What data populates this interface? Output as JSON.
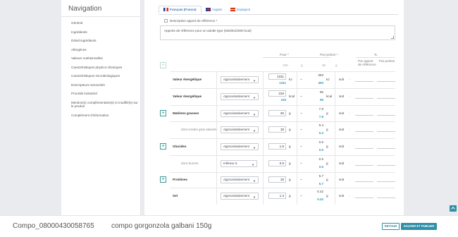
{
  "sidebar": {
    "title": "Navigation",
    "items": [
      {
        "label": "Général"
      },
      {
        "label": "Ingrédients"
      },
      {
        "label": "Détail ingrédients"
      },
      {
        "label": "Allergènes"
      },
      {
        "label": "Valeurs nutritionnelles"
      },
      {
        "label": "Caractéristiques physico-chimiques"
      },
      {
        "label": "Caractéristiques microbiologiques"
      },
      {
        "label": "Descripteurs sensoriels"
      },
      {
        "label": "Procédé industriel"
      },
      {
        "label": "Mention(s) complémentaire(s) si modifié(s) sur le produit"
      },
      {
        "label": "Complément d'information"
      }
    ]
  },
  "lang_tabs": [
    {
      "label": "Français (France)",
      "flag": "fr",
      "active": true
    },
    {
      "label": "Anglais",
      "flag": "en",
      "active": false
    },
    {
      "label": "Espagnol",
      "flag": "es",
      "active": false
    }
  ],
  "description": {
    "label": "Description apport de référence *",
    "value": "Apports de référence pour un adulte type (8400kJ/2000 kcal)"
  },
  "table_header": {
    "pour": "Pour",
    "pour_req": "*",
    "par_portion": "Par portion",
    "par_portion_req": "*",
    "pct": "%",
    "pour_value": "100",
    "pour_unit": "g",
    "portion_value": "30",
    "portion_unit": "g",
    "col_apport": "Par apport de référence",
    "col_portion": "Par portion"
  },
  "rows": [
    {
      "label": "Valeur énergétique",
      "sub": false,
      "plus": false,
      "select": "Approximativement",
      "value": "1311",
      "calc": "1311",
      "unit": "kJ",
      "portion": "393",
      "portion_calc": "393",
      "portion_unit": "kJ",
      "soit": "soit"
    },
    {
      "label": "Valeur énergétique",
      "sub": false,
      "plus": false,
      "select": "Approximativement",
      "value": "316",
      "calc": "316",
      "unit": "kcal",
      "portion": "95",
      "portion_calc": "95",
      "portion_unit": "kcal",
      "soit": "soit"
    },
    {
      "label": "Matières grasses",
      "sub": false,
      "plus": true,
      "select": "Approximativement",
      "value": "26",
      "calc": "",
      "unit": "g",
      "portion": "7.8",
      "portion_calc": "7.8",
      "portion_unit": "g",
      "soit": "soit"
    },
    {
      "label": "dont Acides gras saturés",
      "sub": true,
      "plus": false,
      "select": "Approximativement",
      "value": "18",
      "calc": "",
      "unit": "g",
      "portion": "5.4",
      "portion_calc": "5.4",
      "portion_unit": "g",
      "soit": "soit"
    },
    {
      "label": "Glucides",
      "sub": false,
      "plus": true,
      "select": "Approximativement",
      "value": "1.5",
      "calc": "",
      "unit": "g",
      "portion": "0.5",
      "portion_calc": "0.5",
      "portion_unit": "g",
      "soit": "soit"
    },
    {
      "label": "dont Sucres",
      "sub": true,
      "plus": false,
      "select": "Inférieur à",
      "value": "0.5",
      "calc": "",
      "unit": "g",
      "portion": "0.5",
      "portion_calc": "0.5",
      "portion_unit": "g",
      "soit": "soit"
    },
    {
      "label": "Protéines",
      "sub": false,
      "plus": true,
      "select": "Approximativement",
      "value": "19",
      "calc": "",
      "unit": "g",
      "portion": "5.7",
      "portion_calc": "5.7",
      "portion_unit": "g",
      "soit": "soit"
    },
    {
      "label": "Sel",
      "sub": false,
      "plus": false,
      "select": "Approximativement",
      "value": "1.4",
      "calc": "",
      "unit": "g",
      "portion": "0.42",
      "portion_calc": "0.42",
      "portion_unit": "g",
      "soit": "soit"
    }
  ],
  "bottom": {
    "code": "Compo_08000430058765",
    "name": "compo gorgonzola galbani 150g",
    "retour": "RETOUR",
    "save": "SAUVER ET PUBLIER"
  },
  "colors": {
    "accent": "#2e8fa8",
    "teal": "#3d9a9a",
    "link": "#4a86c8"
  }
}
